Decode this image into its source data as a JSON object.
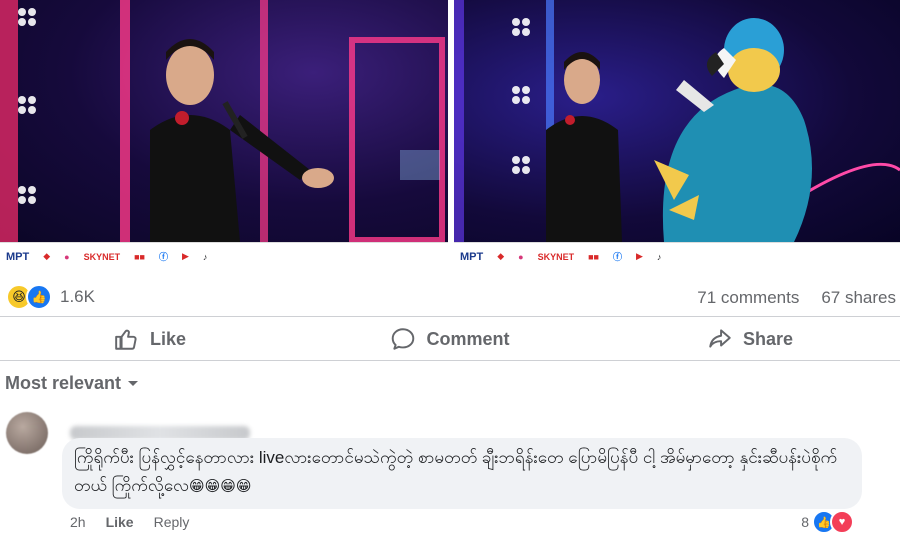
{
  "post": {
    "photos": [
      {
        "subject": "singer-with-microphone",
        "scene": "stage-lights"
      },
      {
        "subject": "singer-and-parrot-mascot",
        "scene": "stage-lights"
      }
    ],
    "sponsors": [
      "MPT",
      "SKYNET",
      "facebook",
      "youtube",
      "tiktok"
    ],
    "reaction_count": "1.6K",
    "comments_count": "71 comments",
    "shares_count": "67 shares"
  },
  "actions": {
    "like": "Like",
    "comment": "Comment",
    "share": "Share"
  },
  "sort": {
    "label": "Most relevant"
  },
  "comment": {
    "text": "ကြိုရိုက်ပီး ပြန်လွှင့်နေတာလား liveလား‌တောင်မသဲကွဲတဲ့ စာမတတ် ချီးဘရိန်းတေ ပြောမိပြန်ပီ ငါ့ အိမ်မှာတော့ နှင်းဆီပန်းပဲစိုက်တယ် ကြိုက်လို့လေ",
    "emojis": "😁😁😁😁",
    "time": "2h",
    "like_label": "Like",
    "reply_label": "Reply",
    "reaction_count": "8"
  },
  "colors": {
    "accent": "#1877f2",
    "muted_text": "#65676b",
    "bubble": "#f0f2f5",
    "love": "#f33e58",
    "haha": "#f7c92a"
  }
}
